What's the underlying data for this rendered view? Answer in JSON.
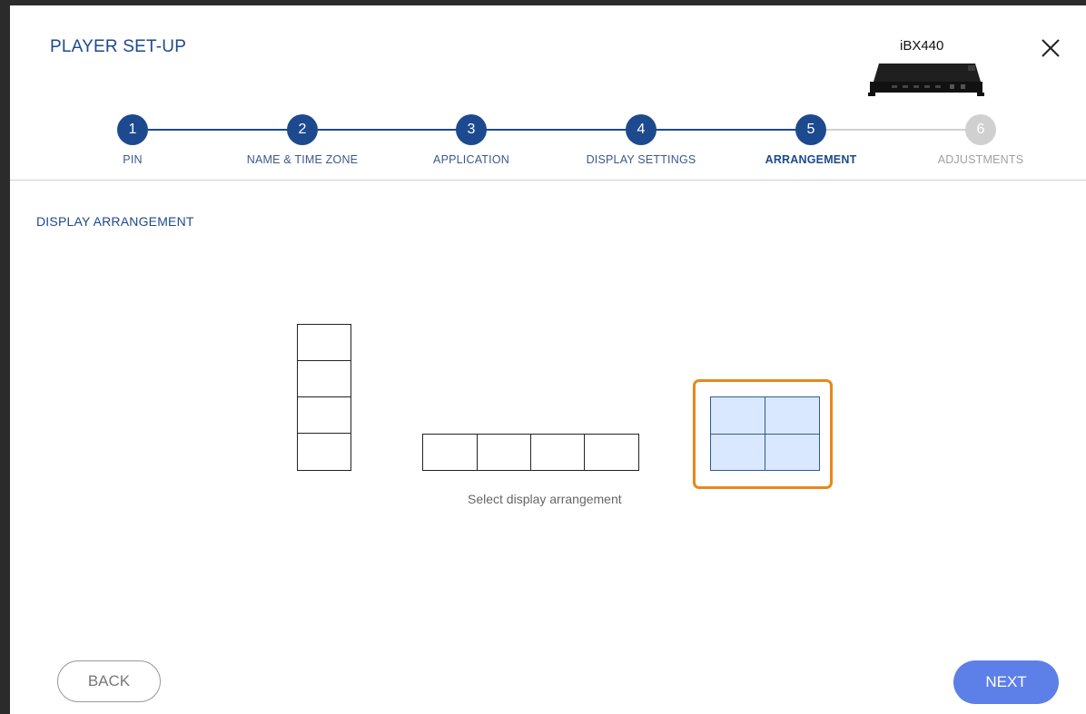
{
  "header": {
    "title": "PLAYER SET-UP",
    "model": "iBX440",
    "close_icon": "close-icon",
    "device_image": "media-player-device"
  },
  "stepper": {
    "steps": [
      {
        "number": "1",
        "label": "PIN",
        "state": "complete"
      },
      {
        "number": "2",
        "label": "NAME & TIME ZONE",
        "state": "complete"
      },
      {
        "number": "3",
        "label": "APPLICATION",
        "state": "complete"
      },
      {
        "number": "4",
        "label": "DISPLAY SETTINGS",
        "state": "complete"
      },
      {
        "number": "5",
        "label": "ARRANGEMENT",
        "state": "current"
      },
      {
        "number": "6",
        "label": "ADJUSTMENTS",
        "state": "disabled"
      }
    ],
    "active_color": "#1d4a8f",
    "inactive_color": "#d0d0d0"
  },
  "main": {
    "section_title": "DISPLAY ARRANGEMENT",
    "hint": "Select display arrangement",
    "options": [
      {
        "name": "vertical-1x4",
        "rows": 4,
        "cols": 1,
        "selected": false
      },
      {
        "name": "horizontal-4x1",
        "rows": 1,
        "cols": 4,
        "selected": false
      },
      {
        "name": "grid-2x2",
        "rows": 2,
        "cols": 2,
        "selected": true
      }
    ],
    "selected_color": "#d9e8ff",
    "highlight_color": "#e8881b"
  },
  "footer": {
    "back_label": "BACK",
    "next_label": "NEXT",
    "next_color": "#5d7fe8"
  }
}
